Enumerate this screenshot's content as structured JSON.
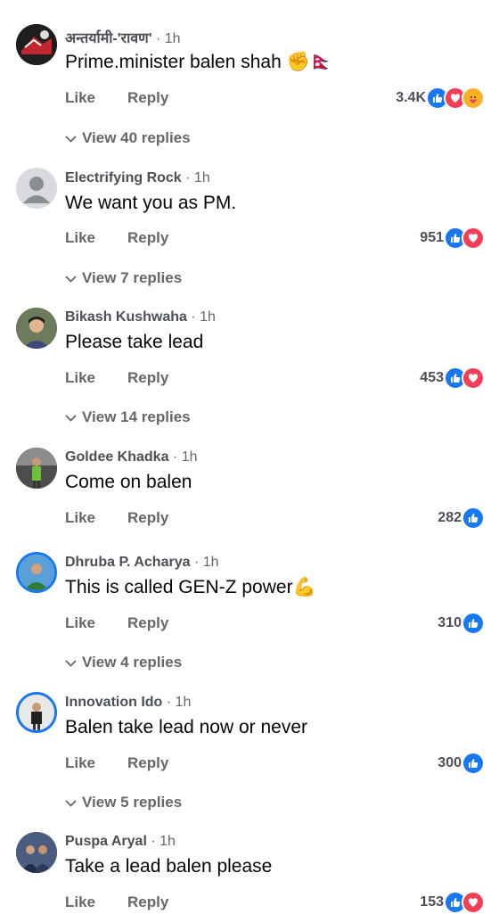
{
  "comments": [
    {
      "author": "अन्तर्यामी-'रावण'",
      "time": "1h",
      "text": "Prime.minister balen shah",
      "emoji": "✊🇳🇵",
      "like": "Like",
      "reply": "Reply",
      "count": "3.4K",
      "reactions": [
        "like",
        "heart",
        "care"
      ],
      "view_replies": "View 40 replies"
    },
    {
      "author": "Electrifying Rock",
      "time": "1h",
      "text": "We want you as PM.",
      "emoji": "",
      "like": "Like",
      "reply": "Reply",
      "count": "951",
      "reactions": [
        "like",
        "heart"
      ],
      "view_replies": "View 7 replies"
    },
    {
      "author": "Bikash Kushwaha",
      "time": "1h",
      "text": "Please take lead",
      "emoji": "",
      "like": "Like",
      "reply": "Reply",
      "count": "453",
      "reactions": [
        "like",
        "heart"
      ],
      "view_replies": "View 14 replies"
    },
    {
      "author": "Goldee Khadka",
      "time": "1h",
      "text": "Come on balen",
      "emoji": "",
      "like": "Like",
      "reply": "Reply",
      "count": "282",
      "reactions": [
        "like"
      ],
      "view_replies": ""
    },
    {
      "author": "Dhruba P. Acharya",
      "time": "1h",
      "text": "This is called GEN-Z power",
      "emoji": "💪",
      "like": "Like",
      "reply": "Reply",
      "count": "310",
      "reactions": [
        "like"
      ],
      "view_replies": "View 4 replies"
    },
    {
      "author": "Innovation Ido",
      "time": "1h",
      "text": "Balen take lead now or never",
      "emoji": "",
      "like": "Like",
      "reply": "Reply",
      "count": "300",
      "reactions": [
        "like"
      ],
      "view_replies": "View 5 replies"
    },
    {
      "author": "Puspa Aryal",
      "time": "1h",
      "text": "Take a lead balen please",
      "emoji": "",
      "like": "Like",
      "reply": "Reply",
      "count": "153",
      "reactions": [
        "like",
        "heart"
      ],
      "view_replies": ""
    }
  ],
  "separator": " · ",
  "colors": {
    "like": "#1877f2",
    "heart": "#f33e58",
    "care": "#f7b125",
    "meta": "#65676b"
  },
  "icons": {
    "like": "thumbs-up-icon",
    "heart": "heart-icon",
    "care": "care-face-icon",
    "chevron": "chevron-down-icon"
  }
}
